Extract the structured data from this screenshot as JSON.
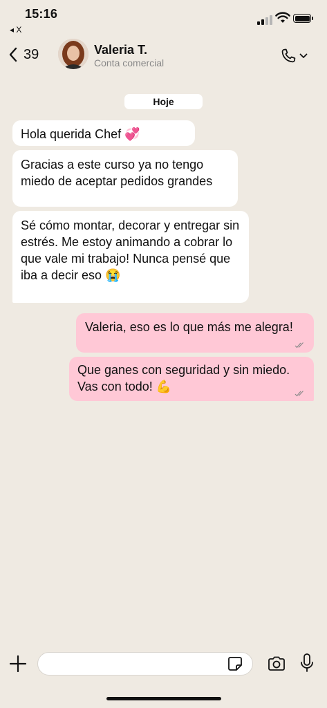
{
  "status": {
    "time": "15:16",
    "back_app": "◂ X"
  },
  "header": {
    "back_count": "39",
    "contact_name": "Valeria T.",
    "contact_subtitle": "Conta comercial"
  },
  "date_separator": "Hoje",
  "messages": [
    {
      "direction": "in",
      "text": "Hola querida Chef",
      "emoji": "💞"
    },
    {
      "direction": "in",
      "text": "Gracias a este curso ya no tengo miedo de aceptar pedidos grandes"
    },
    {
      "direction": "in",
      "text": "Sé cómo montar, decorar y entregar sin estrés. Me estoy animando a cobrar lo que vale mi trabajo! Nunca pensé que iba a decir eso",
      "emoji": "😭"
    },
    {
      "direction": "out",
      "text": "Valeria, eso es lo que más me alegra!",
      "status": "read"
    },
    {
      "direction": "out",
      "text": "Que ganes con seguridad y sin miedo. Vas con todo!",
      "emoji": "💪",
      "status": "read"
    }
  ],
  "input": {
    "placeholder": ""
  },
  "colors": {
    "background": "#efeae2",
    "outgoing_bubble": "#ffc8d6",
    "incoming_bubble": "#ffffff"
  }
}
